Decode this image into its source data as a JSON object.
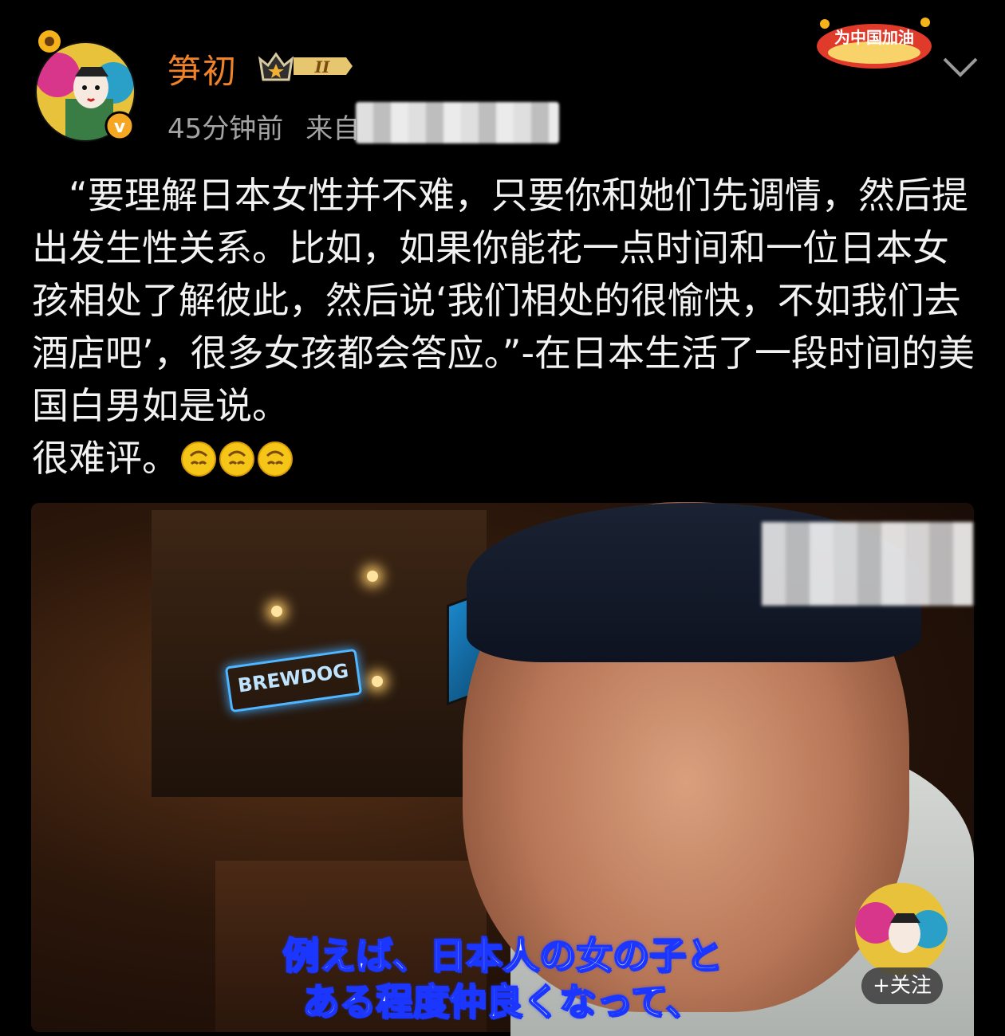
{
  "header": {
    "username": "笋初",
    "rank_level": "II",
    "time": "45分钟前",
    "source_prefix": "来自",
    "badge_text": "为中国加油"
  },
  "post": {
    "lines": [
      "“要理解日本女性并不难，只要你和她们先调情，然后提出发生性关系。比如，如果你能花一点时间和一位日本女孩相处了解彼此，然后说‘我们相处的很愉快，不如我们去酒店吧’，很多女孩都会答应。”-在日本生活了一段时间的美国白男如是说。",
      "很难评。"
    ],
    "emoji_count": 3
  },
  "video": {
    "neon_sign": "BREWDOG",
    "subtitle_line1": "例えば、日本人の女の子と",
    "subtitle_line2": "ある程度仲良くなって、",
    "follow_label": "+关注"
  },
  "colors": {
    "username": "#f0822a",
    "meta": "#a3a3a3",
    "subtitle_outline": "#1a36ff"
  }
}
